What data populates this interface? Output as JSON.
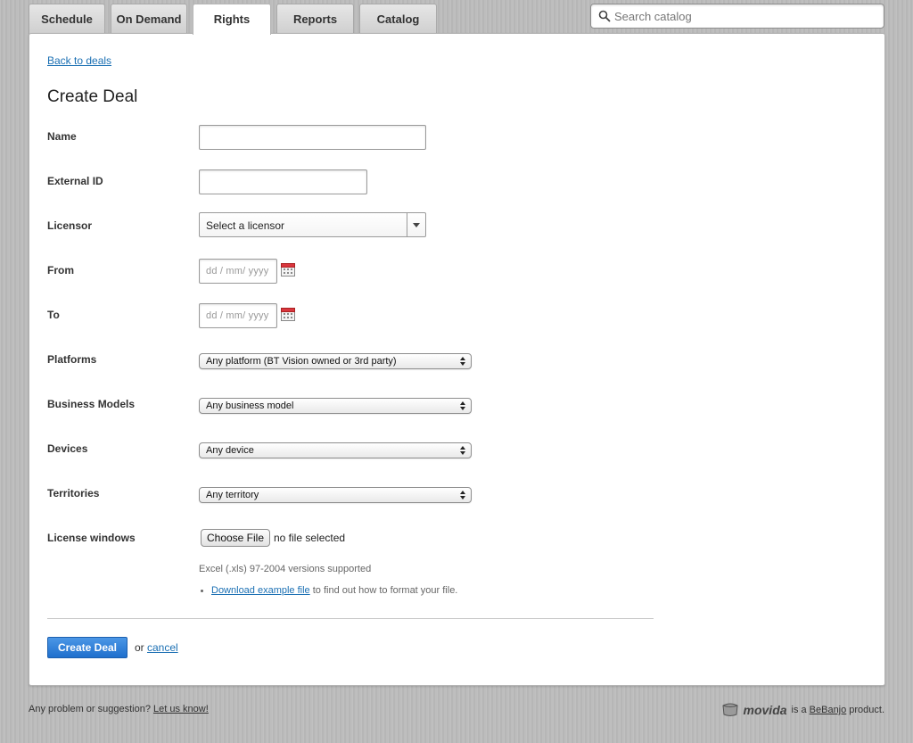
{
  "tabs": [
    {
      "label": "Schedule",
      "active": false
    },
    {
      "label": "On Demand",
      "active": false
    },
    {
      "label": "Rights",
      "active": true
    },
    {
      "label": "Reports",
      "active": false
    },
    {
      "label": "Catalog",
      "active": false
    }
  ],
  "search": {
    "placeholder": "Search catalog",
    "icon": "search-icon"
  },
  "back_link": "Back to deals",
  "page_title": "Create Deal",
  "form": {
    "name": {
      "label": "Name",
      "value": ""
    },
    "external_id": {
      "label": "External ID",
      "value": ""
    },
    "licensor": {
      "label": "Licensor",
      "value": "Select a licensor"
    },
    "from": {
      "label": "From",
      "placeholder": "dd / mm/ yyyy"
    },
    "to": {
      "label": "To",
      "placeholder": "dd / mm/ yyyy"
    },
    "platforms": {
      "label": "Platforms",
      "value": "Any platform (BT Vision owned or 3rd party)"
    },
    "business_models": {
      "label": "Business Models",
      "value": "Any business model"
    },
    "devices": {
      "label": "Devices",
      "value": "Any device"
    },
    "territories": {
      "label": "Territories",
      "value": "Any territory"
    },
    "license_windows": {
      "label": "License windows",
      "choose_button": "Choose File",
      "file_status": "no file selected",
      "hint": "Excel (.xls) 97-2004 versions supported",
      "download_link": "Download example file",
      "download_suffix": " to find out how to format your file."
    }
  },
  "actions": {
    "submit": "Create Deal",
    "or": "or",
    "cancel": "cancel"
  },
  "footer": {
    "question": "Any problem or suggestion?",
    "feedback_link": "Let us know!",
    "brand": "movida",
    "is_a": "is a",
    "company": "BeBanjo",
    "product": "product."
  },
  "colors": {
    "accent": "#1f6fcd",
    "link": "#1a6fb3",
    "background": "#bcbcbc"
  }
}
